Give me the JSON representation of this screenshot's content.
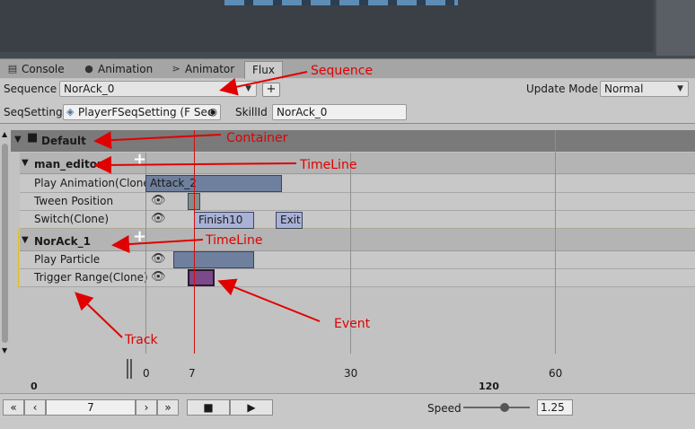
{
  "tabs": [
    {
      "label": "Console",
      "icon": "console-icon"
    },
    {
      "label": "Animation",
      "icon": "animation-icon"
    },
    {
      "label": "Animator",
      "icon": "animator-icon"
    },
    {
      "label": "Flux",
      "icon": ""
    }
  ],
  "toolbar": {
    "sequence_label": "Sequence",
    "sequence_value": "NorAck_0",
    "add_label": "+",
    "update_mode_label": "Update Mode",
    "update_mode_value": "Normal",
    "seqsetting_label": "SeqSetting",
    "seqsetting_value": "PlayerFSeqSetting (F Sec",
    "skillid_label": "SkillId",
    "skillid_value": "NorAck_0"
  },
  "container": {
    "name": "Default",
    "add_label": "+"
  },
  "timelines": [
    {
      "name": "man_editor",
      "add_label": "+",
      "tracks": [
        {
          "name": "Play Animation(Clone)",
          "events": [
            {
              "label": "Attack_2",
              "start": 0,
              "end": 20
            }
          ]
        },
        {
          "name": "Tween Position",
          "events": [
            {
              "label": "",
              "start": 6,
              "end": 8
            }
          ]
        },
        {
          "name": "Switch(Clone)",
          "events": [
            {
              "label": "Finish10",
              "start": 7,
              "end": 16
            },
            {
              "label": "Exit",
              "start": 19,
              "end": 23
            }
          ]
        }
      ]
    },
    {
      "name": "NorAck_1",
      "add_label": "+",
      "tracks": [
        {
          "name": "Play Particle",
          "events": [
            {
              "label": "",
              "start": 4,
              "end": 16
            }
          ]
        },
        {
          "name": "Trigger Range(Clone)",
          "events": [
            {
              "label": "",
              "start": 6,
              "end": 10
            }
          ]
        }
      ]
    }
  ],
  "ruler": {
    "ticks": [
      "0",
      "7",
      "30",
      "60"
    ],
    "range_start": "0",
    "range_end": "120",
    "current_frame": 7
  },
  "playback": {
    "frame_value": "7",
    "speed_label": "Speed",
    "speed_value": "1.25"
  },
  "annotations": {
    "sequence": "Sequence",
    "container": "Container",
    "timeline1": "TimeLine",
    "timeline2": "TimeLine",
    "event": "Event",
    "track": "Track"
  },
  "colors": {
    "annotation_red": "#e00000",
    "event_blue": "#6f7f9e",
    "event_light": "#a9b2d6",
    "event_purple": "#7a4a8a",
    "cursor_red": "#d01010"
  }
}
